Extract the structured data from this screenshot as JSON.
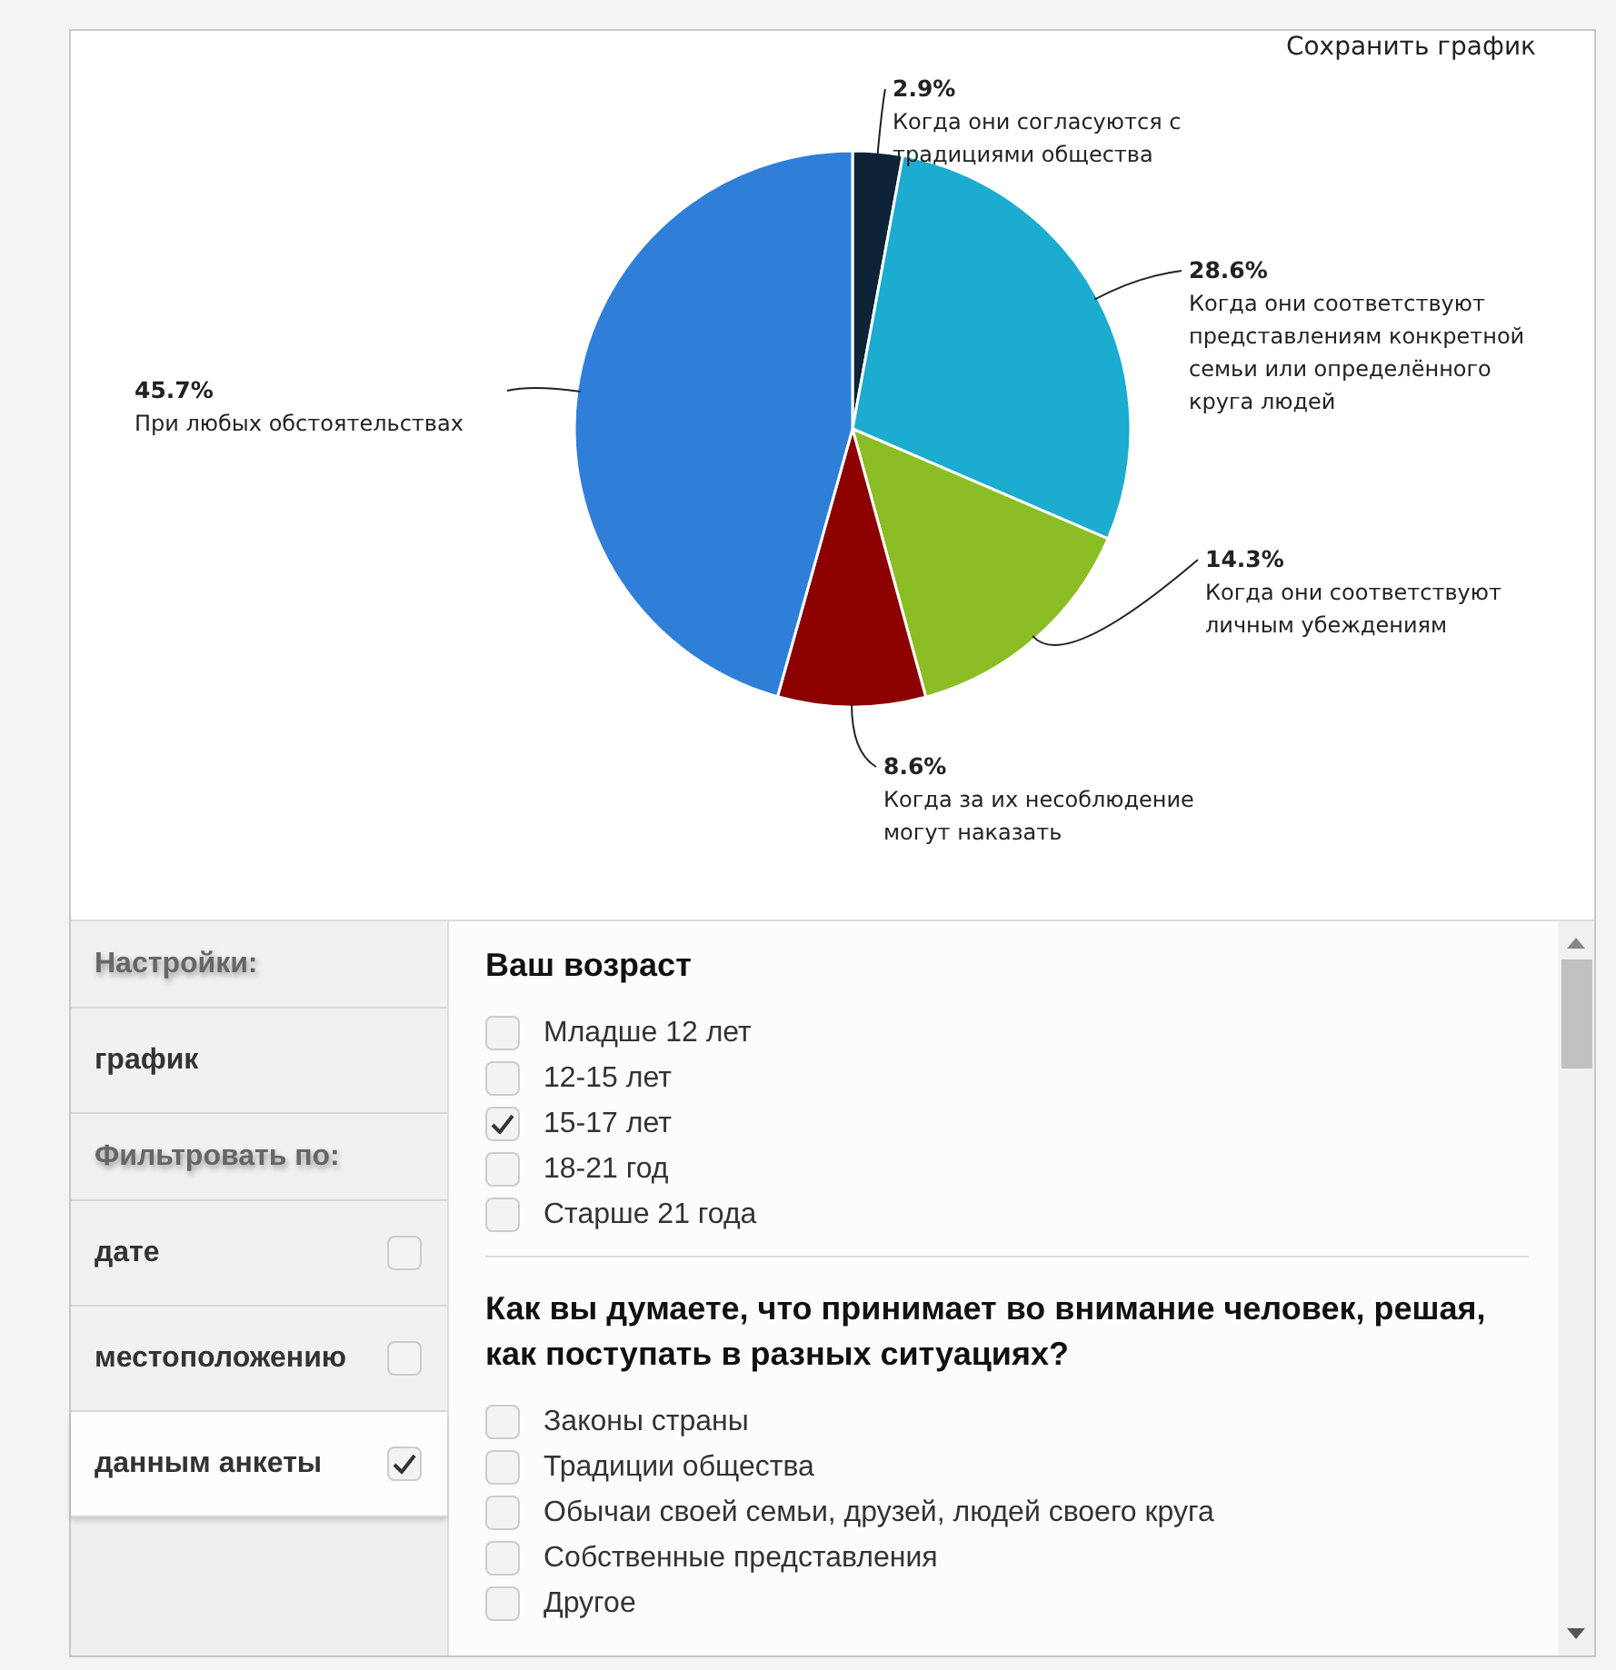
{
  "save_link": "Сохранить график",
  "chart": {
    "chart_data": {
      "type": "pie",
      "categories": [
        "Когда они согласуются с традициями общества",
        "Когда они соответствуют представлениям конкретной семьи или определённого круга людей",
        "Когда они соответствуют личным убеждениям",
        "Когда за их несоблюдение могут наказать",
        "При любых обстоятельствах"
      ],
      "values": [
        2.9,
        28.6,
        14.3,
        8.6,
        45.7
      ],
      "colors": [
        "#0e2238",
        "#1baccf",
        "#8bbd24",
        "#8c0000",
        "#2f7fd8"
      ],
      "value_labels": [
        "2.9%",
        "28.6%",
        "14.3%",
        "8.6%",
        "45.7%"
      ]
    }
  },
  "sidebar": {
    "items": [
      {
        "kind": "header",
        "label": "Настройки:"
      },
      {
        "kind": "item",
        "label": "график"
      },
      {
        "kind": "header",
        "label": "Фильтровать по:"
      },
      {
        "kind": "filter",
        "label": "дате",
        "checked": false,
        "selected": false
      },
      {
        "kind": "filter",
        "label": "местоположению",
        "checked": false,
        "selected": false
      },
      {
        "kind": "filter",
        "label": "данным анкеты",
        "checked": true,
        "selected": true
      }
    ]
  },
  "questions": [
    {
      "title": "Ваш возраст",
      "options": [
        {
          "label": "Младше 12 лет",
          "checked": false
        },
        {
          "label": "12-15 лет",
          "checked": false
        },
        {
          "label": "15-17 лет",
          "checked": true
        },
        {
          "label": "18-21 год",
          "checked": false
        },
        {
          "label": "Старше 21 года",
          "checked": false
        }
      ]
    },
    {
      "title": "Как вы думаете, что принимает во внимание человек, решая, как поступать в разных ситуациях?",
      "options": [
        {
          "label": "Законы страны",
          "checked": false
        },
        {
          "label": "Традиции общества",
          "checked": false
        },
        {
          "label": "Обычаи своей семьи, друзей, людей своего круга",
          "checked": false
        },
        {
          "label": "Собственные представления",
          "checked": false
        },
        {
          "label": "Другое",
          "checked": false
        }
      ]
    }
  ]
}
